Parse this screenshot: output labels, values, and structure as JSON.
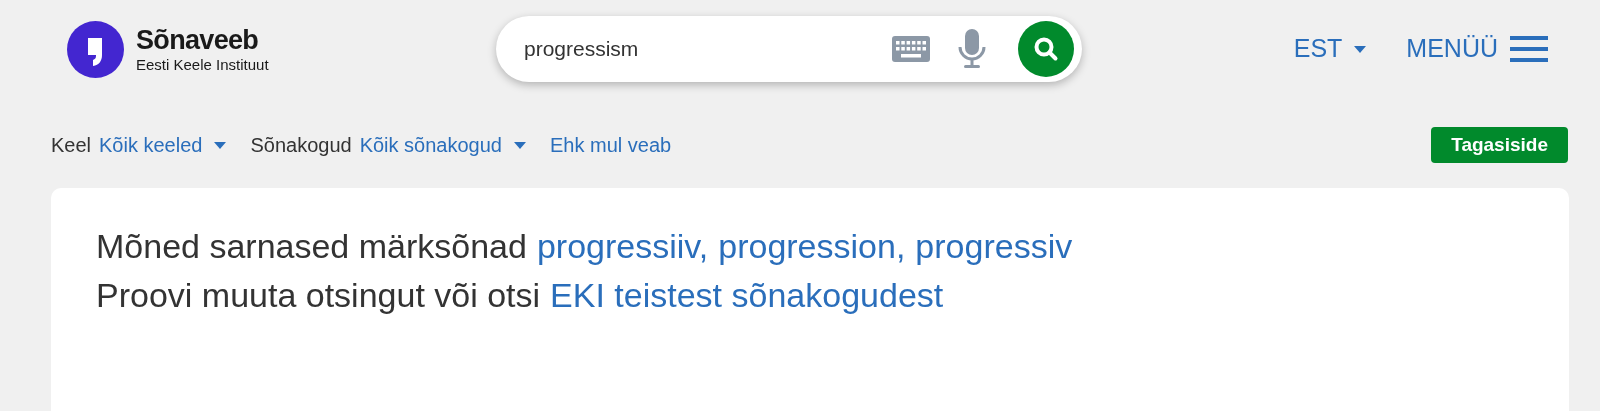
{
  "header": {
    "logo": {
      "title": "Sõnaveeb",
      "subtitle": "Eesti Keele Instituut"
    },
    "search": {
      "value": "progressism"
    },
    "language": "EST",
    "menu": "MENÜÜ"
  },
  "filters": [
    {
      "label": "Keel",
      "value": "Kõik keeled"
    },
    {
      "label": "Sõnakogud",
      "value": "Kõik sõnakogud"
    }
  ],
  "typo_link": "Ehk mul veab",
  "feedback_button": "Tagasiside",
  "result": {
    "lines": [
      {
        "text": "Mõned sarnased märksõnad",
        "links": [
          "progressiiv,",
          "progression,",
          "progressiv"
        ]
      },
      {
        "text": "Proovi muuta otsingut või otsi",
        "links": [
          "EKI teistest sõnakogudest"
        ]
      }
    ]
  }
}
